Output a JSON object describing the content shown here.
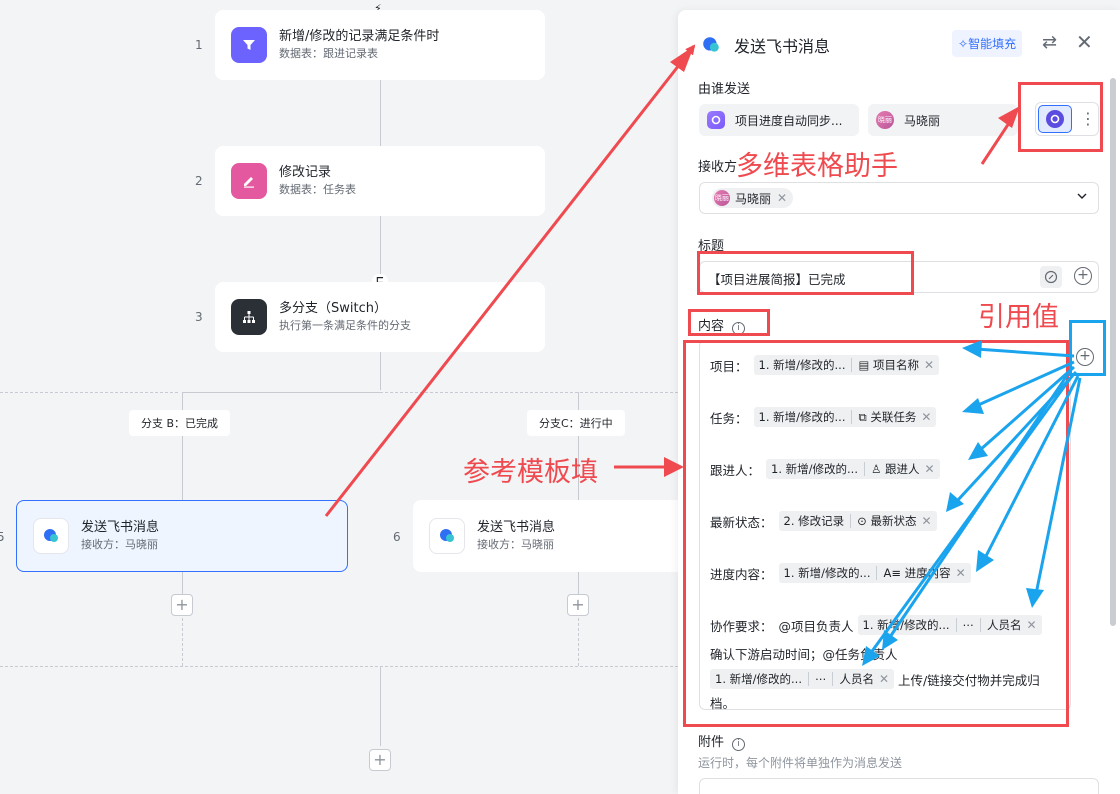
{
  "flow": {
    "steps": [
      {
        "num": "1",
        "title": "新增/修改的记录满足条件时",
        "sub": "数据表：跟进记录表"
      },
      {
        "num": "2",
        "title": "修改记录",
        "sub": "数据表：任务表"
      },
      {
        "num": "3",
        "title": "多分支（Switch）",
        "sub": "执行第一条满足条件的分支"
      }
    ],
    "branches": [
      {
        "tag": "分支 B：已完成",
        "num": "5",
        "title": "发送飞书消息",
        "sub": "接收方：马晓丽"
      },
      {
        "tag": "分支C：进行中",
        "num": "6",
        "title": "发送飞书消息",
        "sub": "接收方：马晓丽"
      }
    ],
    "plus": "+"
  },
  "panel": {
    "title": "发送飞书消息",
    "ai_fill": "智能填充",
    "sender_label": "由谁发送",
    "sender_bot": "项目进度自动同步...",
    "sender_user": "马晓丽",
    "receiver_label": "接收方",
    "receiver_tag": "马晓丽",
    "avatar_text": "晓丽",
    "title_label": "标题",
    "title_value": "【项目进展简报】已完成",
    "content_label": "内容",
    "content_rows": [
      {
        "label": "项目：",
        "source": "1. 新增/修改的...",
        "field": "项目名称"
      },
      {
        "label": "任务：",
        "source": "1. 新增/修改的...",
        "field": "关联任务"
      },
      {
        "label": "跟进人：",
        "source": "1. 新增/修改的...",
        "field": "跟进人"
      },
      {
        "label": "最新状态：",
        "source": "2. 修改记录",
        "field": "最新状态"
      },
      {
        "label": "进度内容：",
        "source": "1. 新增/修改的...",
        "field": "进度内容"
      }
    ],
    "collab": {
      "label": "协作要求：",
      "mention1": "@项目负责人",
      "source1": "1. 新增/修改的...",
      "field1": "人员名",
      "line2": "确认下游启动时间；@任务负责人",
      "source2": "1. 新增/修改的...",
      "field2": "人员名",
      "tail": "上传/链接交付物并完成归",
      "end": "档。"
    },
    "attach_label": "附件",
    "attach_hint": "运行时，每个附件将单独作为消息发送"
  },
  "annotations": {
    "assistant": "多维表格助手",
    "ref_value": "引用值",
    "template": "参考模板填"
  },
  "colors": {
    "annot_red": "#ef4a4f",
    "annot_blue": "#1aa4ee",
    "accent": "#3370ff"
  }
}
